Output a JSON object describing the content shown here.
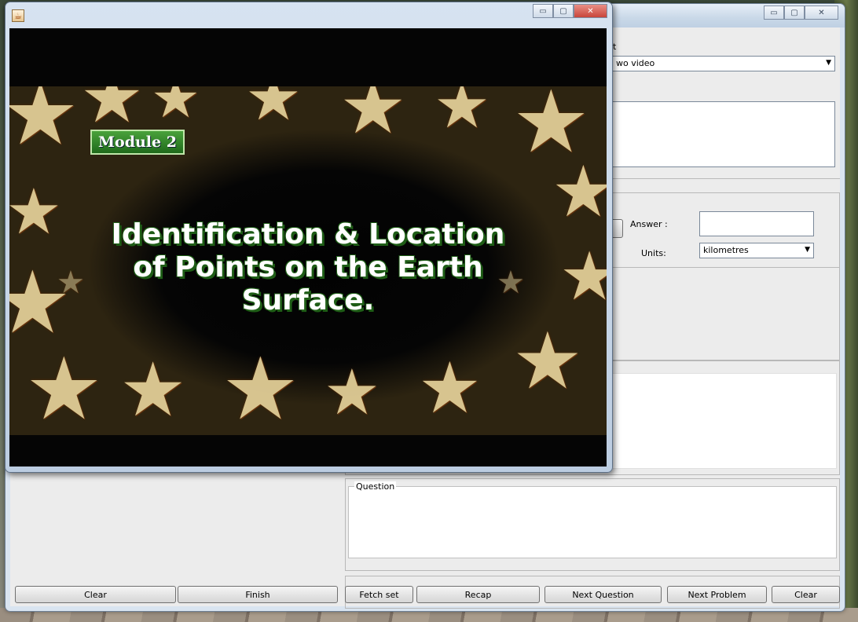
{
  "main_window": {
    "top_label": "t",
    "source_combo_value": "wo video",
    "answer_label": "Answer :",
    "answer_value": "",
    "units_label": "Units:",
    "units_value": "kilometres",
    "question_title": "Question",
    "left_buttons": {
      "clear": "Clear",
      "finish": "Finish"
    },
    "right_buttons": {
      "fetch_set": "Fetch set",
      "recap": "Recap",
      "next_question": "Next Question",
      "next_problem": "Next Problem",
      "clear": "Clear"
    },
    "window_controls": {
      "minimize": "▭",
      "maximize": "▢",
      "close": "✕"
    }
  },
  "video_window": {
    "app_icon": "java-icon",
    "window_controls": {
      "minimize": "▭",
      "maximize": "▢",
      "close": "✕"
    },
    "module_badge": "Module 2",
    "title_lines": [
      "Identification & Location",
      "of Points on the Earth",
      "Surface."
    ]
  },
  "colors": {
    "window_frame": "#bfd0e3",
    "client_bg": "#ececec",
    "close_button": "#c8453a",
    "badge_green": "#2f8a2a",
    "star": "#e6d29a"
  }
}
